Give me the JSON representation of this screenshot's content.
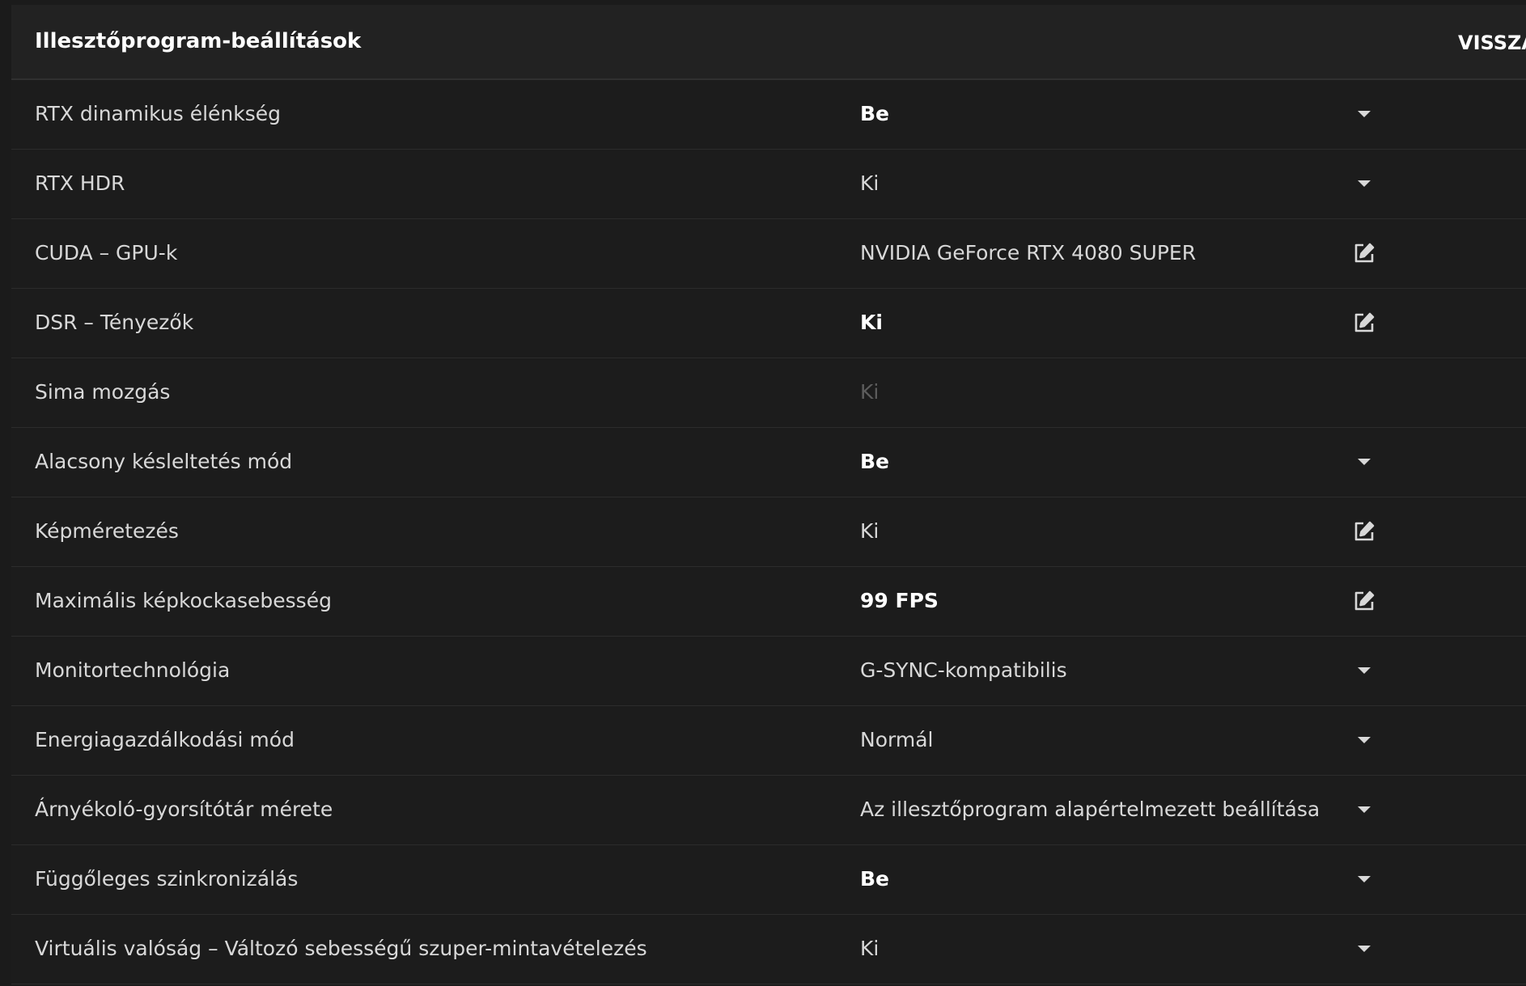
{
  "header": {
    "title": "Illesztőprogram-beállítások",
    "back_label": "VISSZA"
  },
  "settings": [
    {
      "label": "RTX dinamikus élénkség",
      "value": "Be",
      "emphasis": "bold",
      "control": "dropdown"
    },
    {
      "label": "RTX HDR",
      "value": "Ki",
      "emphasis": "normal",
      "control": "dropdown"
    },
    {
      "label": "CUDA – GPU-k",
      "value": "NVIDIA GeForce RTX 4080 SUPER",
      "emphasis": "normal",
      "control": "edit"
    },
    {
      "label": "DSR – Tényezők",
      "value": "Ki",
      "emphasis": "bold",
      "control": "edit"
    },
    {
      "label": "Sima mozgás",
      "value": "Ki",
      "emphasis": "disabled",
      "control": "none"
    },
    {
      "label": "Alacsony késleltetés mód",
      "value": "Be",
      "emphasis": "bold",
      "control": "dropdown"
    },
    {
      "label": "Képméretezés",
      "value": "Ki",
      "emphasis": "normal",
      "control": "edit"
    },
    {
      "label": "Maximális képkockasebesség",
      "value": "99 FPS",
      "emphasis": "bold",
      "control": "edit"
    },
    {
      "label": "Monitortechnológia",
      "value": "G-SYNC-kompatibilis",
      "emphasis": "normal",
      "control": "dropdown"
    },
    {
      "label": "Energiagazdálkodási mód",
      "value": "Normál",
      "emphasis": "normal",
      "control": "dropdown"
    },
    {
      "label": "Árnyékoló-gyorsítótár mérete",
      "value": "Az illesztőprogram alapértelmezett beállítása",
      "emphasis": "normal",
      "control": "dropdown"
    },
    {
      "label": "Függőleges szinkronizálás",
      "value": "Be",
      "emphasis": "bold",
      "control": "dropdown"
    },
    {
      "label": "Virtuális valóság – Változó sebességű szuper-mintavételezés",
      "value": "Ki",
      "emphasis": "normal",
      "control": "dropdown"
    }
  ],
  "icons": {
    "dropdown": "chevron-down-icon",
    "edit": "edit-icon"
  },
  "colors": {
    "background": "#1b1b1b",
    "header_background": "#222222",
    "text": "#d8d8d8",
    "text_bold": "#ffffff",
    "text_disabled": "#5c5c5c",
    "divider": "#2c2c2c"
  }
}
